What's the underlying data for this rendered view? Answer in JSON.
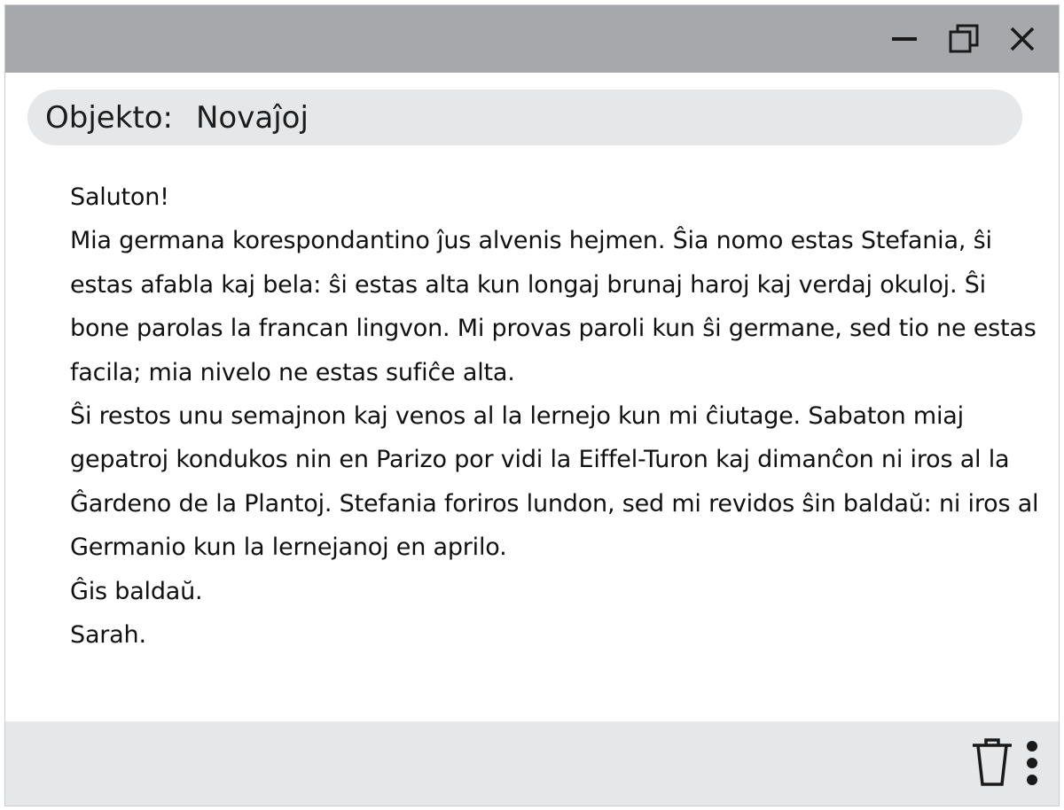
{
  "window": {
    "controls": {
      "minimize_icon": "minimize-icon",
      "maximize_icon": "restore-icon",
      "close_icon": "close-icon"
    }
  },
  "message": {
    "subject_label": "Objekto:",
    "subject_value": "Novaĵoj",
    "lines": [
      "Saluton!",
      "Mia germana korespondantino ĵus alvenis hejmen. Ŝia nomo estas Stefania, ŝi estas afabla kaj bela: ŝi estas alta kun longaj brunaj haroj kaj verdaj okuloj. Ŝi bone parolas la francan lingvon. Mi provas paroli kun ŝi germane, sed tio ne estas facila; mia nivelo ne estas sufiĉe alta.",
      "Ŝi restos unu semajnon kaj venos al la lernejo kun mi ĉiutage. Sabaton miaj gepatroj kondukos nin en Parizo por vidi la Eiffel-Turon kaj dimanĉon ni iros al la Ĝardeno de la Plantoj. Stefania foriros lundon, sed mi revidos ŝin baldaŭ: ni iros al Germanio kun la lernejanoj en aprilo.",
      "Ĝis baldaŭ.",
      "Sarah."
    ]
  },
  "footer": {
    "delete_icon": "trash-icon",
    "more_icon": "more-vertical-icon"
  },
  "colors": {
    "titlebar": "#a7a8ab",
    "subject_bar": "#e6e7e9",
    "footer": "#e6e7e9",
    "icon": "#1a1a1a"
  }
}
